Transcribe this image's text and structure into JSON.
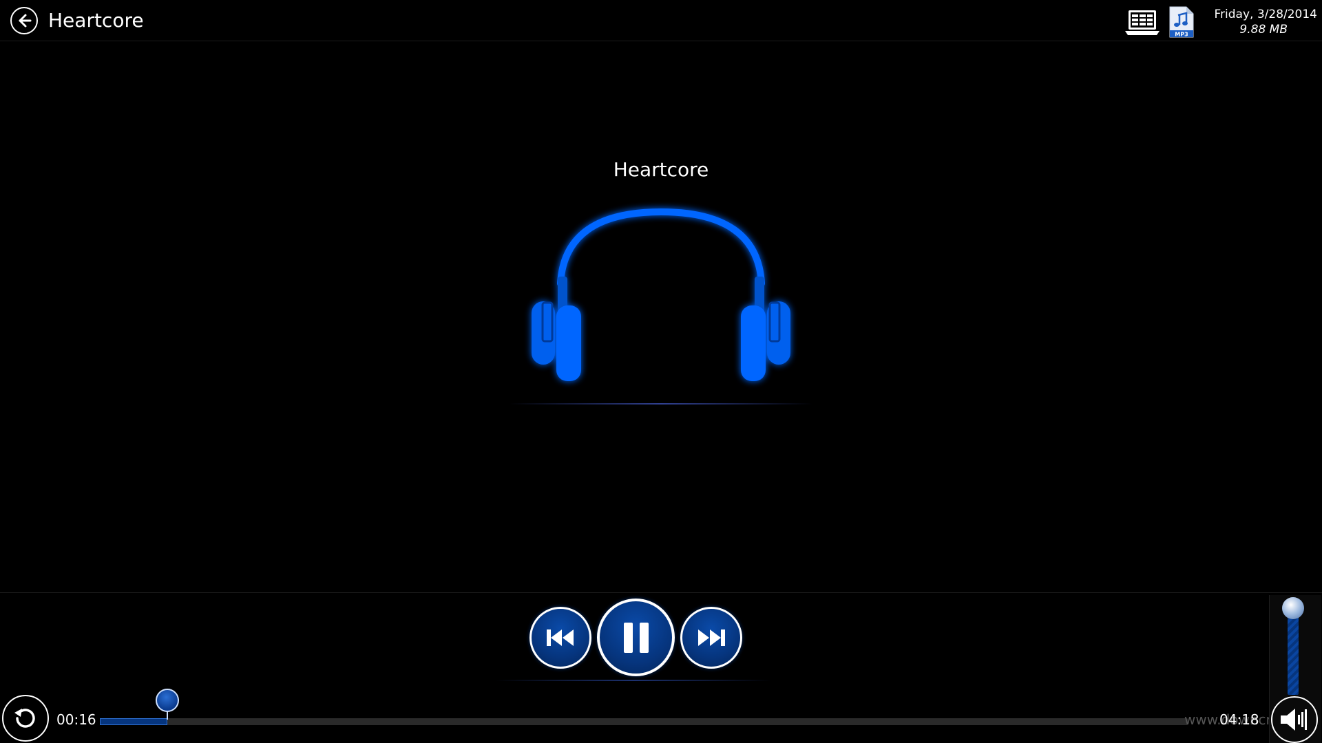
{
  "header": {
    "title": "Heartcore",
    "back_icon": "back-arrow-icon",
    "date": "Friday, 3/28/2014",
    "file_size": "9.88 MB",
    "file_type_badge": "MP3"
  },
  "track": {
    "title": "Heartcore",
    "art_icon": "headphones-icon"
  },
  "playback": {
    "elapsed": "00:16",
    "total": "04:18",
    "progress_fraction": 0.062,
    "state": "playing"
  },
  "volume": {
    "level_fraction": 1.0
  },
  "watermark": "www.downcrea.com",
  "colors": {
    "accent": "#0a4aa8",
    "accent_dark": "#06357e",
    "headphones": "#0066ff"
  }
}
